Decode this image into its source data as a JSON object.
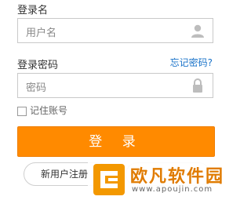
{
  "login_form": {
    "username_label": "登录名",
    "username_placeholder": "用户名",
    "password_label": "登录密码",
    "forgot_link": "忘记密码?",
    "password_placeholder": "密码",
    "remember_label": "记住账号",
    "login_button": "登 录",
    "register_button": "新用户注册"
  },
  "watermark": {
    "title": "欧凡软件园",
    "url": "www.apoujin.com"
  },
  "colors": {
    "accent": "#ff8a00",
    "link": "#1a73c9",
    "border": "#c9c9c9"
  },
  "icons": {
    "username": "user-icon",
    "password": "lock-icon"
  }
}
